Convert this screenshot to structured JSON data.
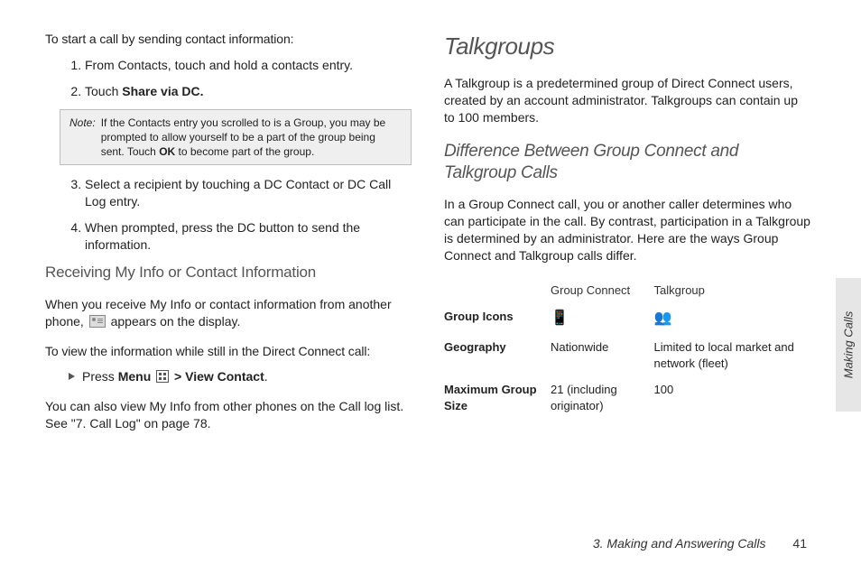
{
  "left": {
    "lead": "To start a call by sending contact information:",
    "step1": "From Contacts, touch and hold a contacts entry.",
    "step2_pre": "Touch ",
    "step2_bold": "Share via DC.",
    "note_label": "Note:",
    "note_body_pre": "If the Contacts entry you scrolled to is a Group, you may be prompted to allow yourself to be a part of the group being sent. Touch ",
    "note_body_bold": "OK",
    "note_body_post": " to become part of the group.",
    "step3": "Select a recipient by touching a DC Contact or DC Call Log entry.",
    "step4": "When prompted, press the DC button to send the information.",
    "h3_receive": "Receiving My Info or Contact Information",
    "receive_p_pre": "When you receive My Info or contact information from another phone, ",
    "receive_p_post": " appears on the display.",
    "view_lead": "To view the information while still in the Direct Connect call:",
    "bullet_pre": "Press ",
    "bullet_menu": "Menu",
    "bullet_gt": " > ",
    "bullet_view": "View Contact",
    "bullet_end": ".",
    "also_p": "You can also view My Info from other phones on the Call log list. See \"7. Call Log\" on page 78."
  },
  "right": {
    "h1": "Talkgroups",
    "p1": "A Talkgroup is a predetermined group of Direct Connect users, created by an account administrator. Talkgroups can contain up to 100 members.",
    "h2": "Difference Between Group Connect and Talkgroup Calls",
    "p2": "In a Group Connect call, you or another caller determines who can participate in the call. By contrast, participation in a Talkgroup is determined by an administrator. Here are the ways Group Connect and Talkgroup calls differ.",
    "th_gc": "Group Connect",
    "th_tg": "Talkgroup",
    "row_icons": "Group Icons",
    "row_geo": "Geography",
    "geo_gc": "Nationwide",
    "geo_tg": "Limited to local market and network (fleet)",
    "row_max": "Maximum Group Size",
    "max_gc": "21 (including originator)",
    "max_tg": "100"
  },
  "sidebar_label": "Making Calls",
  "footer_chapter": "3. Making and Answering Calls",
  "footer_page": "41"
}
